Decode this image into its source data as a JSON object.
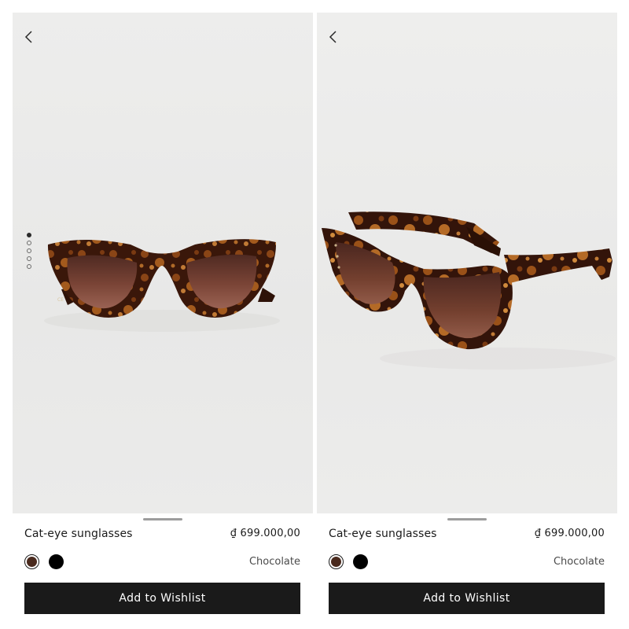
{
  "panels": [
    {
      "product_name": "Cat-eye sunglasses",
      "price": "₫ 699.000,00",
      "selected_color": "Chocolate",
      "swatches": [
        "#4a2a1e",
        "#000000"
      ],
      "wishlist_label": "Add to Wishlist",
      "gallery": {
        "image_count": 5,
        "active_index": 0
      }
    },
    {
      "product_name": "Cat-eye sunglasses",
      "price": "₫ 699.000,00",
      "selected_color": "Chocolate",
      "swatches": [
        "#4a2a1e",
        "#000000"
      ],
      "wishlist_label": "Add to Wishlist"
    }
  ],
  "icons": {
    "back": "chevron-left-icon"
  },
  "colors": {
    "button_bg": "#1a1a1a",
    "photo_bg": "#ebebea",
    "tortoise_dark": "#3a170a",
    "tortoise_light": "#b0621f",
    "lens": "#6e3a2e"
  }
}
